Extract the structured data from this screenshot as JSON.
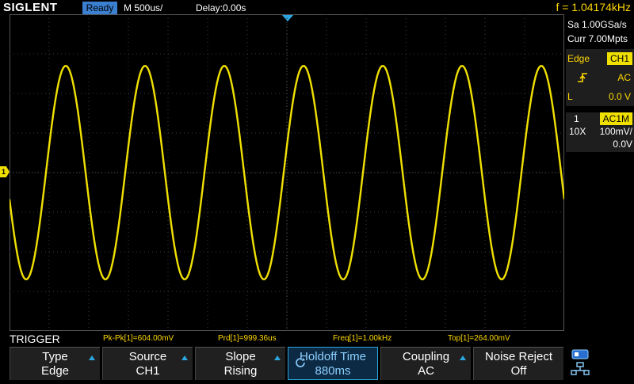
{
  "header": {
    "brand": "SIGLENT",
    "status": "Ready",
    "timebase": "M 500us/",
    "delay": "Delay:0.00s",
    "frequency": "f = 1.04174kHz"
  },
  "acquisition": {
    "sample_rate": "Sa 1.00GSa/s",
    "memory_depth": "Curr 7.00Mpts"
  },
  "trigger_panel": {
    "type": "Edge",
    "source": "CH1",
    "coupling": "AC",
    "level_label": "L",
    "level": "0.0 V"
  },
  "channel_panel": {
    "channel": "1",
    "coupling": "AC1M",
    "probe": "10X",
    "scale": "100mV/",
    "offset": "0.0V"
  },
  "channel_marker": "1",
  "menu_title": "TRIGGER",
  "measurements": [
    {
      "label": "Pk-Pk[1]=604.00mV"
    },
    {
      "label": "Prd[1]=999.36us"
    },
    {
      "label": "Freq[1]=1.00kHz"
    },
    {
      "label": "Top[1]=264.00mV"
    }
  ],
  "softkeys": [
    {
      "line1": "Type",
      "line2": "Edge"
    },
    {
      "line1": "Source",
      "line2": "CH1"
    },
    {
      "line1": "Slope",
      "line2": "Rising"
    },
    {
      "line1": "Holdoff Time",
      "line2": "880ms"
    },
    {
      "line1": "Coupling",
      "line2": "AC"
    },
    {
      "line1": "Noise Reject",
      "line2": "Off"
    }
  ],
  "colors": {
    "trace": "#f0e000",
    "accent": "#2aa7e0",
    "status_bg": "#3a7fd0"
  },
  "waveform": {
    "periods_per_screen": 7.0,
    "amplitude_divisions": 3.0
  }
}
